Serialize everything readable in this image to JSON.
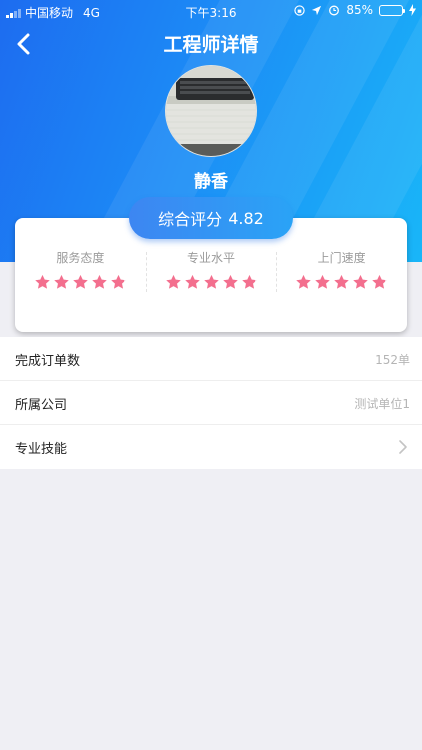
{
  "status_bar": {
    "carrier": "中国移动",
    "network": "4G",
    "time": "下午3:16",
    "battery": "85%",
    "battery_level": 0.85
  },
  "nav": {
    "title": "工程师详情",
    "back_icon": "chevron-left-icon"
  },
  "profile": {
    "name": "静香"
  },
  "rating": {
    "summary_label": "综合评分",
    "summary_value": "4.82",
    "metrics": [
      {
        "label": "服务态度",
        "stars": 4.82
      },
      {
        "label": "专业水平",
        "stars": 4.82
      },
      {
        "label": "上门速度",
        "stars": 4.82
      }
    ],
    "star_color": "#f36f8e"
  },
  "details": [
    {
      "label": "完成订单数",
      "value": "152单"
    },
    {
      "label": "所属公司",
      "value": "测试单位1"
    },
    {
      "label": "专业技能",
      "value": ""
    }
  ],
  "colors": {
    "header_start": "#1d6cf0",
    "header_end": "#19b6f8"
  }
}
